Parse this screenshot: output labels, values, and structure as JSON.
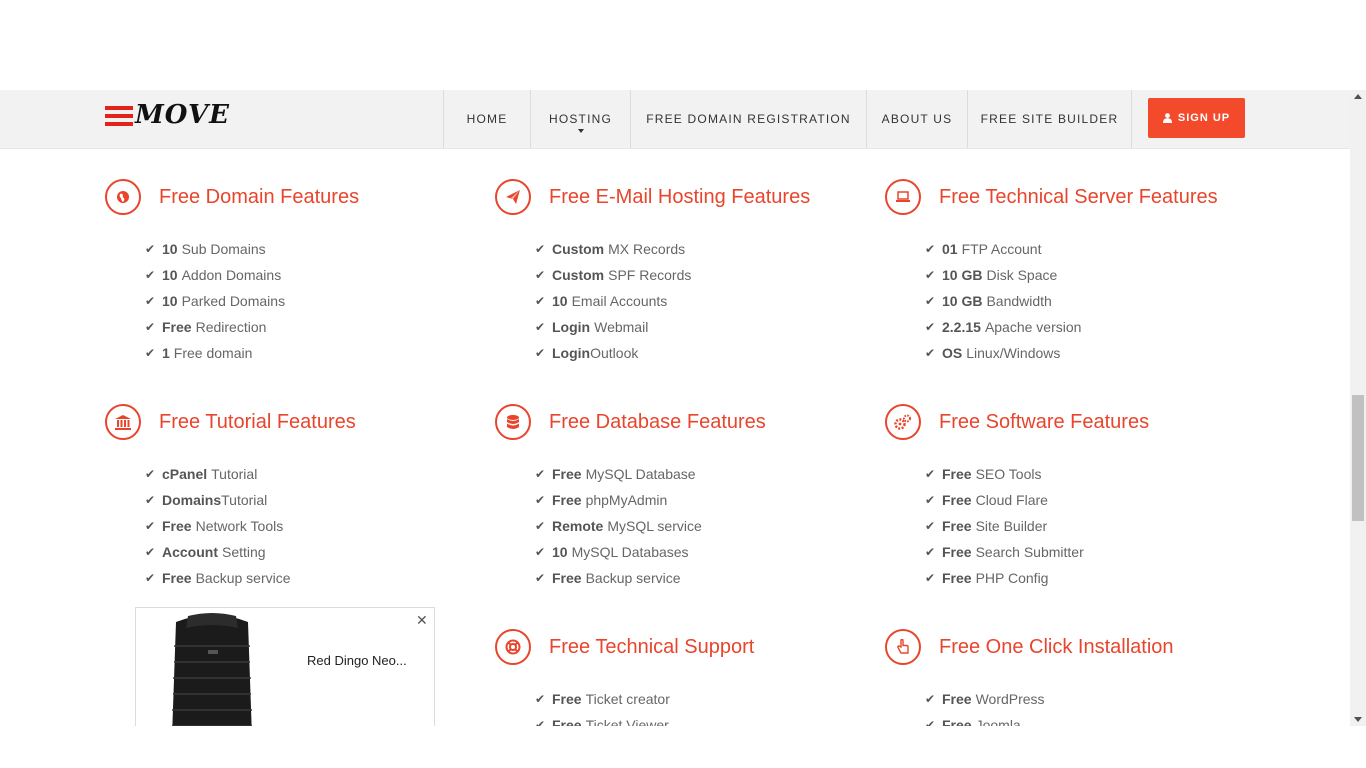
{
  "logo": {
    "text": "MOVE"
  },
  "nav": {
    "items": [
      {
        "label": "HOME"
      },
      {
        "label": "HOSTING"
      },
      {
        "label": "FREE DOMAIN REGISTRATION"
      },
      {
        "label": "ABOUT US"
      },
      {
        "label": "FREE SITE BUILDER"
      }
    ],
    "signup_label": "SIGN UP"
  },
  "features": [
    {
      "title": "Free Domain Features",
      "icon": "globe-icon",
      "items": [
        {
          "bold": "10",
          "text": "Sub Domains"
        },
        {
          "bold": "10",
          "text": "Addon Domains"
        },
        {
          "bold": "10",
          "text": "Parked Domains"
        },
        {
          "bold": "Free",
          "text": "Redirection"
        },
        {
          "bold": "1",
          "text": "Free domain"
        }
      ]
    },
    {
      "title": "Free E-Mail Hosting Features",
      "icon": "paper-plane-icon",
      "items": [
        {
          "bold": "Custom",
          "text": "MX Records"
        },
        {
          "bold": "Custom",
          "text": "SPF Records"
        },
        {
          "bold": "10",
          "text": "Email Accounts"
        },
        {
          "bold": "Login",
          "text": "Webmail"
        },
        {
          "bold": "Login",
          "text": "Outlook"
        }
      ]
    },
    {
      "title": "Free Technical Server Features",
      "icon": "laptop-icon",
      "items": [
        {
          "bold": "01",
          "text": "FTP Account"
        },
        {
          "bold": "10 GB",
          "text": "Disk Space"
        },
        {
          "bold": "10 GB",
          "text": "Bandwidth"
        },
        {
          "bold": "2.2.15",
          "text": "Apache version"
        },
        {
          "bold": "OS",
          "text": "Linux/Windows"
        }
      ]
    },
    {
      "title": "Free Tutorial Features",
      "icon": "institution-icon",
      "items": [
        {
          "bold": "cPanel",
          "text": "Tutorial"
        },
        {
          "bold": "Domains",
          "text": "Tutorial"
        },
        {
          "bold": "Free",
          "text": "Network Tools"
        },
        {
          "bold": "Account",
          "text": "Setting"
        },
        {
          "bold": "Free",
          "text": "Backup service"
        }
      ]
    },
    {
      "title": "Free Database Features",
      "icon": "database-icon",
      "items": [
        {
          "bold": "Free",
          "text": "MySQL Database"
        },
        {
          "bold": "Free",
          "text": "phpMyAdmin"
        },
        {
          "bold": "Remote",
          "text": "MySQL service"
        },
        {
          "bold": "10",
          "text": "MySQL Databases"
        },
        {
          "bold": "Free",
          "text": "Backup service"
        }
      ]
    },
    {
      "title": "Free Software Features",
      "icon": "gears-icon",
      "items": [
        {
          "bold": "Free",
          "text": "SEO Tools"
        },
        {
          "bold": "Free",
          "text": "Cloud Flare"
        },
        {
          "bold": "Free",
          "text": "Site Builder"
        },
        {
          "bold": "Free",
          "text": "Search Submitter"
        },
        {
          "bold": "Free",
          "text": "PHP Config"
        }
      ]
    },
    {
      "title": "Free Technical Support",
      "icon": "life-ring-icon",
      "items": [
        {
          "bold": "Free",
          "text": "Ticket creator"
        },
        {
          "bold": "Free",
          "text": "Ticket Viewer"
        }
      ]
    },
    {
      "title": "Free One Click Installation",
      "icon": "hand-pointer-icon",
      "items": [
        {
          "bold": "Free",
          "text": "WordPress"
        },
        {
          "bold": "Free",
          "text": "Joomla"
        }
      ]
    }
  ],
  "ad": {
    "text": "Red Dingo Neo...",
    "close": "✕"
  },
  "colors": {
    "accent": "#e8452c",
    "signup": "#f44a2c",
    "logo_red": "#e3231b"
  }
}
